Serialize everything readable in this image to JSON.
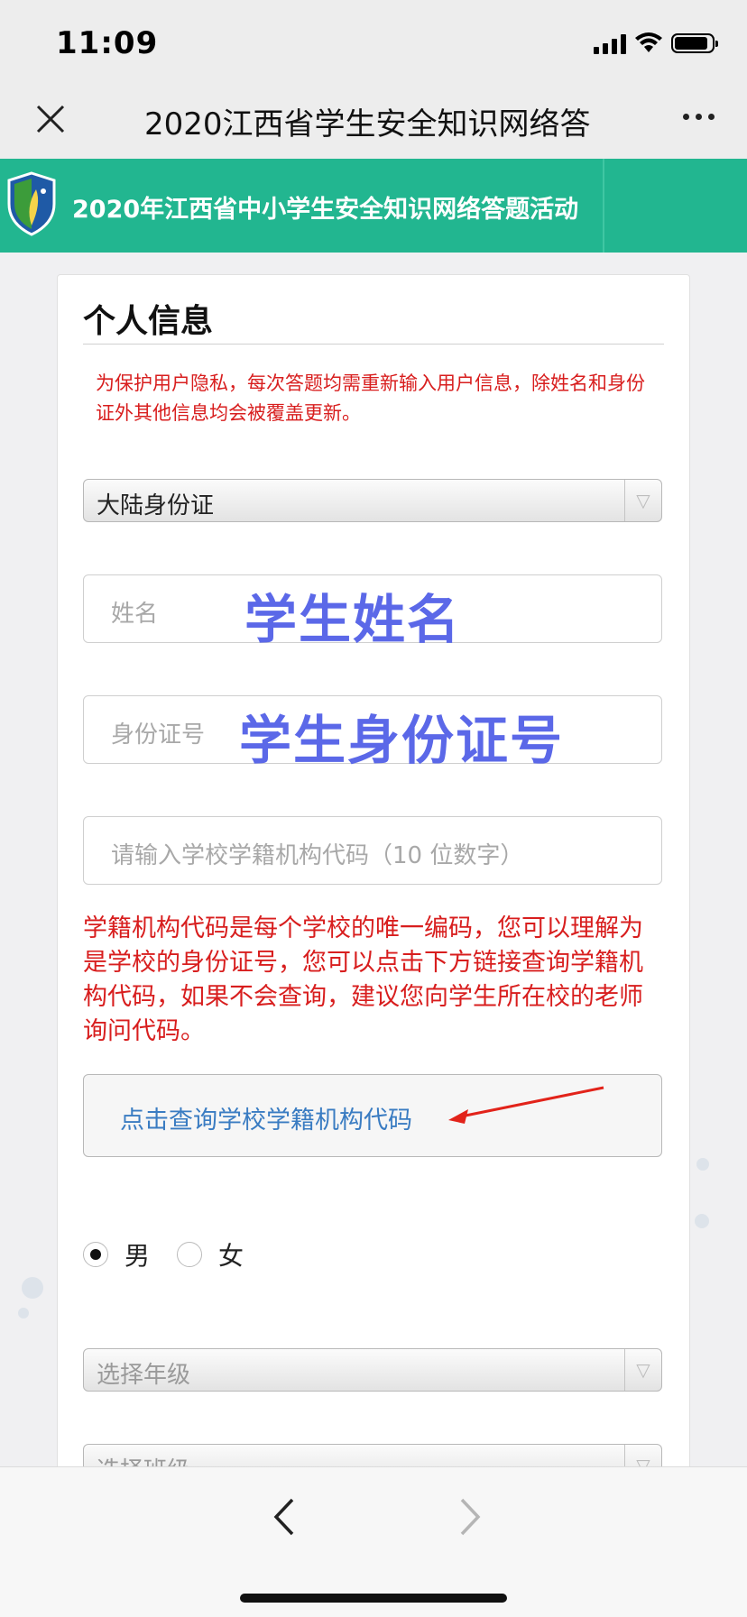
{
  "status_bar": {
    "time": "11:09",
    "signal_icon": "cellular-signal-icon",
    "wifi_icon": "wifi-icon",
    "battery_icon": "battery-icon"
  },
  "nav": {
    "title": "2020江西省学生安全知识网络答",
    "close_icon": "close-icon",
    "more_icon": "more-dots-icon"
  },
  "banner": {
    "title": "2020年江西省中小学生安全知识网络答题活动",
    "logo_icon": "shield-logo-icon",
    "colors": {
      "background": "#22b690"
    }
  },
  "form": {
    "section_title": "个人信息",
    "privacy_note": "为保护用户隐私，每次答题均需重新输入用户信息，除姓名和身份证外其他信息均会被覆盖更新。",
    "id_type": {
      "selected": "大陆身份证"
    },
    "name_field": {
      "placeholder": "姓名",
      "overlay": "学生姓名"
    },
    "id_field": {
      "placeholder": "身份证号",
      "overlay": "学生身份证号"
    },
    "school_code_field": {
      "placeholder": "请输入学校学籍机构代码（10 位数字）"
    },
    "school_code_note": "学籍机构代码是每个学校的唯一编码，您可以理解为是学校的身份证号，您可以点击下方链接查询学籍机构代码，如果不会查询，建议您向学生所在校的老师询问代码。",
    "lookup_link": "点击查询学校学籍机构代码",
    "gender": {
      "options": [
        "男",
        "女"
      ],
      "selected": "男"
    },
    "grade_select": {
      "placeholder": "选择年级"
    },
    "class_select": {
      "placeholder": "选择班级"
    }
  },
  "toolbar": {
    "back_icon": "back-chevron-icon",
    "forward_icon": "forward-chevron-icon"
  },
  "colors": {
    "accent": "#22b690",
    "warning": "#d81e1e",
    "link": "#3a7cc2",
    "overlay": "#5b68e8"
  }
}
